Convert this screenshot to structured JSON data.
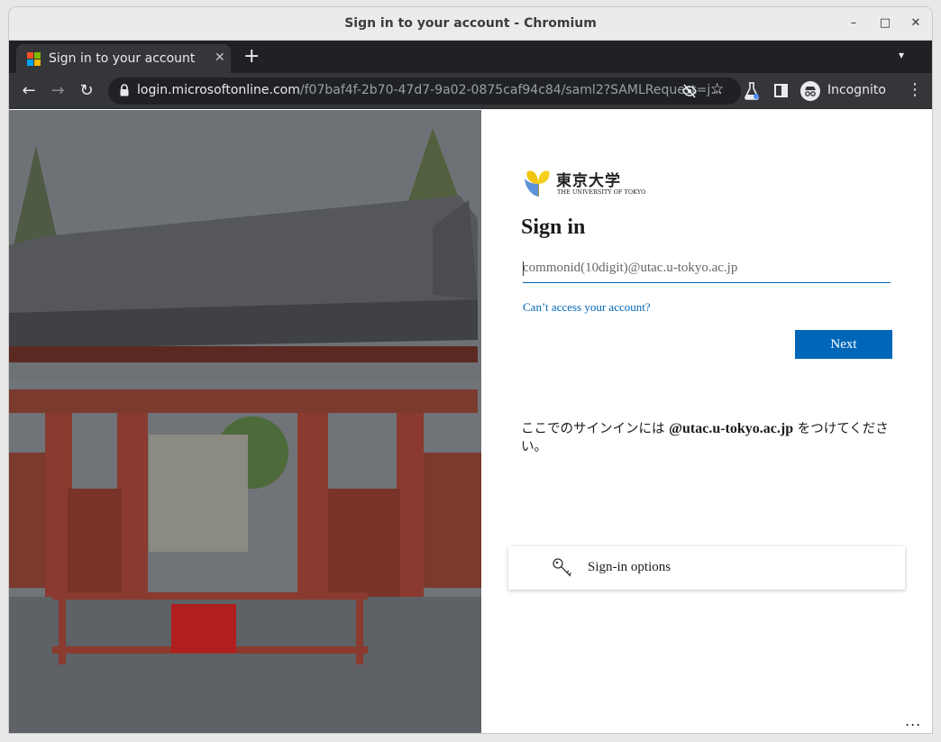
{
  "window": {
    "title": "Sign in to your account - Chromium",
    "minimize": "–",
    "maximize": "□",
    "close": "✕"
  },
  "tab": {
    "label": "Sign in to your account",
    "close": "✕"
  },
  "tabbar": {
    "new_tab": "+",
    "menu": "▾"
  },
  "toolbar": {
    "back": "←",
    "forward": "→",
    "reload": "↻",
    "url_host": "login.microsoftonline.com",
    "url_path": "/f07baf4f-2b70-47d7-9a02-0875caf94c84/saml2?SAMLRequest=j...",
    "star": "☆",
    "incognito_label": "Incognito",
    "menu": "⋮"
  },
  "signin": {
    "logo_jp": "東京大学",
    "logo_en": "THE UNIVERSITY OF TOKYO",
    "heading": "Sign in",
    "email_placeholder": "commonid(10digit)@utac.u-tokyo.ac.jp",
    "cant_access": "Can’t access your account?",
    "next": "Next",
    "notice_pre": "ここでのサインインには ",
    "notice_domain": "@utac.u-tokyo.ac.jp",
    "notice_post": " をつけてください。",
    "options_label": "Sign-in options",
    "more": "..."
  },
  "colors": {
    "accent": "#0067b8",
    "tab_bg": "#35363a",
    "frame_bg": "#202124",
    "gate_red": "#8a3a2e"
  }
}
